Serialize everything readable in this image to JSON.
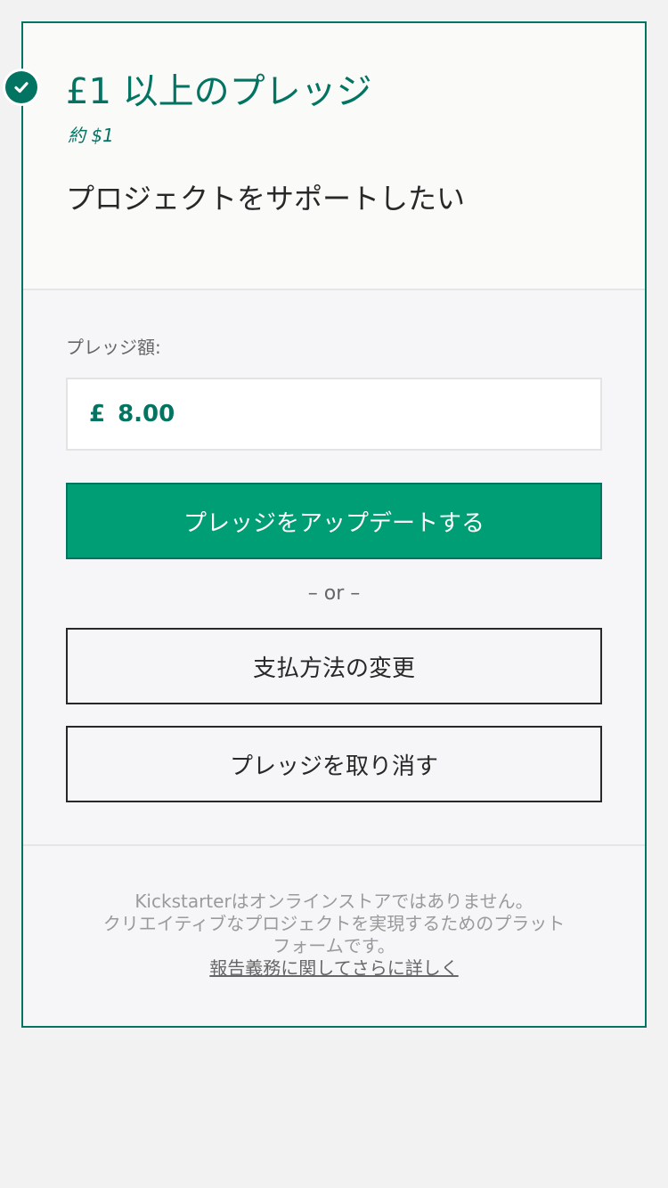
{
  "reward": {
    "title": "£1 以上のプレッジ",
    "approx": "約 $1",
    "description": "プロジェクトをサポートしたい",
    "check_icon": "check-circle-icon"
  },
  "pledge": {
    "label": "プレッジ額:",
    "currency_symbol": "£",
    "amount": "8.00"
  },
  "actions": {
    "update_label": "プレッジをアップデートする",
    "or_label": "– or –",
    "change_payment_label": "支払方法の変更",
    "cancel_label": "プレッジを取り消す"
  },
  "footer": {
    "disclaimer_line1": "Kickstarterはオンラインストアではありません。",
    "disclaimer_line2": "クリエイティブなプロジェクトを実現するためのプラット",
    "disclaimer_line3": "フォームです。",
    "link_label": "報告義務に関してさらに詳しく"
  },
  "colors": {
    "brand": "#037362",
    "primary_button": "#009e74",
    "text_dark": "#282828",
    "text_muted": "#666666"
  }
}
